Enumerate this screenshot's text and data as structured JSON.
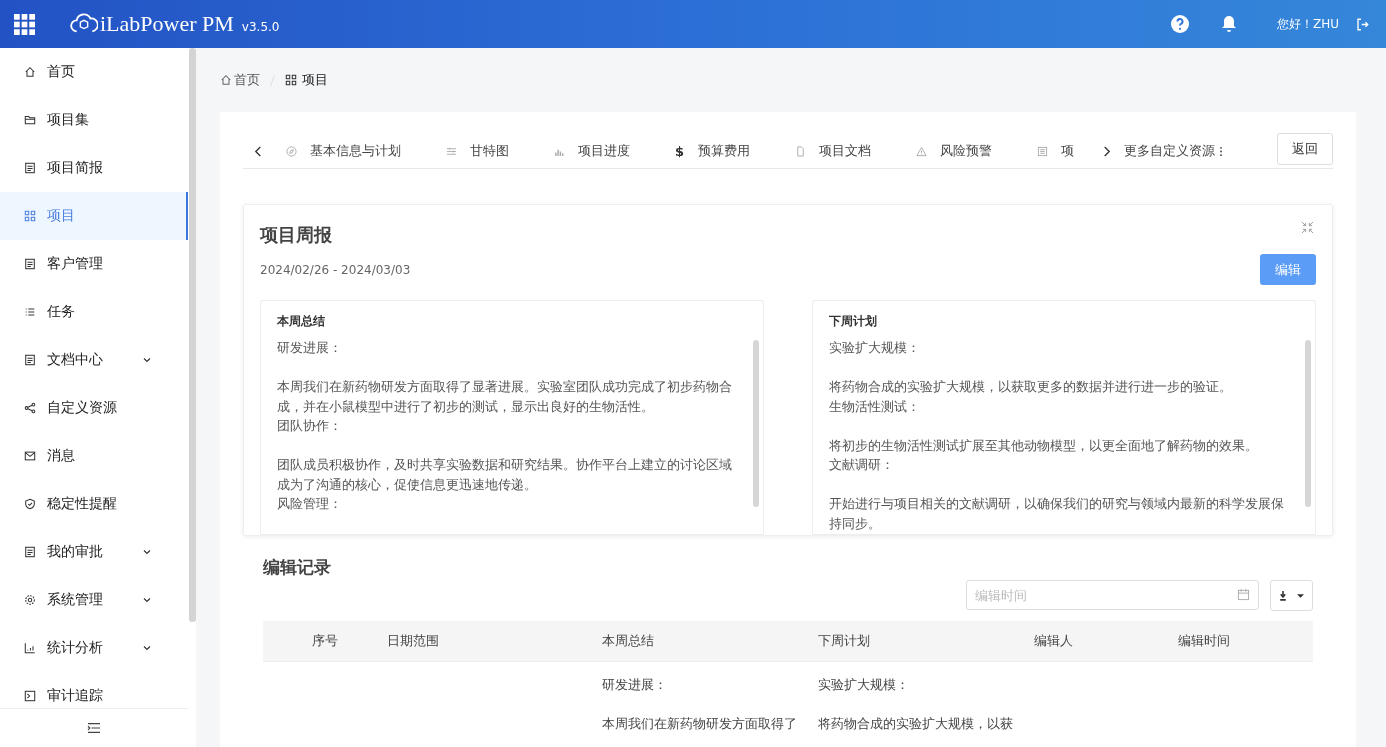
{
  "header": {
    "logo": "iLabPower PM",
    "version": "v3.5.0",
    "greeting": "您好！ZHU"
  },
  "sidebar": {
    "items": [
      {
        "label": "首页",
        "selected": false,
        "expandable": false
      },
      {
        "label": "项目集",
        "selected": false,
        "expandable": false
      },
      {
        "label": "项目简报",
        "selected": false,
        "expandable": false
      },
      {
        "label": "项目",
        "selected": true,
        "expandable": false
      },
      {
        "label": "客户管理",
        "selected": false,
        "expandable": false
      },
      {
        "label": "任务",
        "selected": false,
        "expandable": false
      },
      {
        "label": "文档中心",
        "selected": false,
        "expandable": true
      },
      {
        "label": "自定义资源",
        "selected": false,
        "expandable": false
      },
      {
        "label": "消息",
        "selected": false,
        "expandable": false
      },
      {
        "label": "稳定性提醒",
        "selected": false,
        "expandable": false
      },
      {
        "label": "我的审批",
        "selected": false,
        "expandable": true
      },
      {
        "label": "系统管理",
        "selected": false,
        "expandable": true
      },
      {
        "label": "统计分析",
        "selected": false,
        "expandable": true
      },
      {
        "label": "审计追踪",
        "selected": false,
        "expandable": false
      }
    ]
  },
  "breadcrumb": [
    "首页",
    "项目"
  ],
  "tabs": [
    {
      "label": "基本信息与计划"
    },
    {
      "label": "甘特图"
    },
    {
      "label": "项目进度"
    },
    {
      "label": "预算费用",
      "icon_text": "$"
    },
    {
      "label": "项目文档"
    },
    {
      "label": "风险预警"
    },
    {
      "label": "项"
    }
  ],
  "more_tabs": "更多自定义资源",
  "back_button": "返回",
  "weekly_report": {
    "title": "项目周报",
    "date_range": "2024/02/26 - 2024/03/03",
    "edit_button": "编辑",
    "panels": [
      {
        "title": "本周总结",
        "lines": [
          {
            "kind": "heading",
            "text": "研发进展："
          },
          {
            "kind": "body",
            "text": "本周我们在新药物研发方面取得了显著进展。实验室团队成功完成了初步药物合成，并在小鼠模型中进行了初步的测试，显示出良好的生物活性。"
          },
          {
            "kind": "heading",
            "text": "团队协作："
          },
          {
            "kind": "body",
            "text": "团队成员积极协作，及时共享实验数据和研究结果。协作平台上建立的讨论区域成为了沟通的核心，促使信息更迅速地传递。"
          },
          {
            "kind": "body",
            "text": "风险管理："
          }
        ]
      },
      {
        "title": "下周计划",
        "lines": [
          {
            "kind": "heading",
            "text": "实验扩大规模："
          },
          {
            "kind": "body",
            "text": "将药物合成的实验扩大规模，以获取更多的数据并进行进一步的验证。"
          },
          {
            "kind": "heading",
            "text": "生物活性测试："
          },
          {
            "kind": "body",
            "text": "将初步的生物活性测试扩展至其他动物模型，以更全面地了解药物的效果。"
          },
          {
            "kind": "heading",
            "text": "文献调研："
          },
          {
            "kind": "body",
            "text": "开始进行与项目相关的文献调研，以确保我们的研究与领域内最新的科学发展保持同步。"
          }
        ]
      }
    ]
  },
  "edit_records": {
    "title": "编辑记录",
    "date_filter": {
      "placeholder": "编辑时间"
    },
    "table": {
      "columns": [
        "序号",
        "日期范围",
        "本周总结",
        "下周计划",
        "编辑人",
        "编辑时间"
      ],
      "rows": [
        {
          "cells": [
            [],
            [],
            [
              "研发进展：",
              "本周我们在新药物研发方面取得了"
            ],
            [
              "实验扩大规模：",
              "将药物合成的实验扩大规模，以获"
            ],
            [],
            []
          ]
        }
      ]
    }
  }
}
